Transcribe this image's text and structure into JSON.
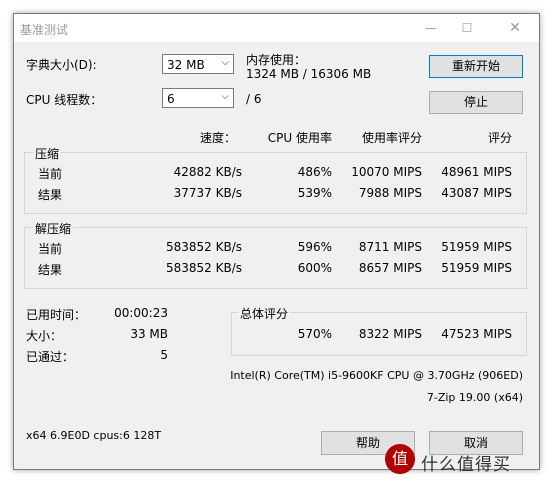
{
  "window": {
    "title": "基准测试"
  },
  "dictionary": {
    "label": "字典大小(D):",
    "value": "32 MB"
  },
  "memory": {
    "label": "内存使用：",
    "value": "1324 MB / 16306 MB"
  },
  "threads": {
    "label": "CPU 线程数：",
    "value": "6",
    "total": "/ 6"
  },
  "buttons": {
    "restart": "重新开始",
    "stop": "停止",
    "help": "帮助",
    "cancel": "取消"
  },
  "headers": {
    "speed": "速度：",
    "cpu_usage": "CPU 使用率",
    "usage_rating": "使用率评分",
    "rating": "评分"
  },
  "compress": {
    "label": "压缩",
    "current": {
      "label": "当前",
      "speed": "42882 KB/s",
      "cpu": "486%",
      "usage_rating": "10070 MIPS",
      "rating": "48961 MIPS"
    },
    "result": {
      "label": "结果",
      "speed": "37737 KB/s",
      "cpu": "539%",
      "usage_rating": "7988 MIPS",
      "rating": "43087 MIPS"
    }
  },
  "decompress": {
    "label": "解压缩",
    "current": {
      "label": "当前",
      "speed": "583852 KB/s",
      "cpu": "596%",
      "usage_rating": "8711 MIPS",
      "rating": "51959 MIPS"
    },
    "result": {
      "label": "结果",
      "speed": "583852 KB/s",
      "cpu": "600%",
      "usage_rating": "8657 MIPS",
      "rating": "51959 MIPS"
    }
  },
  "stats": {
    "elapsed": {
      "label": "已用时间：",
      "value": "00:00:23"
    },
    "size": {
      "label": "大小：",
      "value": "33 MB"
    },
    "passes": {
      "label": "已通过：",
      "value": "5"
    }
  },
  "total": {
    "label": "总体评分",
    "cpu": "570%",
    "usage_rating": "8322 MIPS",
    "rating": "47523 MIPS"
  },
  "cpu_info": "Intel(R) Core(TM) i5-9600KF CPU @ 3.70GHz (906ED)",
  "version": "7-Zip 19.00 (x64)",
  "system": "x64 6.9E0D cpus:6 128T",
  "watermark": {
    "logo": "值",
    "text": "什么值得买"
  }
}
